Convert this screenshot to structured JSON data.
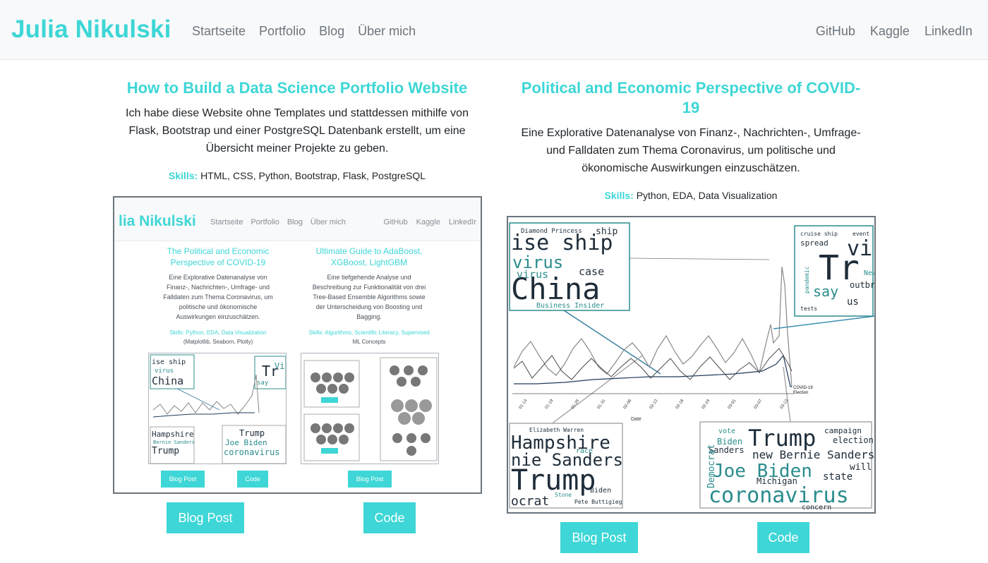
{
  "navbar": {
    "brand": "Julia Nikulski",
    "left_links": [
      "Startseite",
      "Portfolio",
      "Blog",
      "Über mich"
    ],
    "right_links": [
      "GitHub",
      "Kaggle",
      "LinkedIn"
    ]
  },
  "cards": [
    {
      "title": "How to Build a Data Science Portfolio Website",
      "description": "Ich habe diese Website ohne Templates und stattdessen mithilfe von Flask, Bootstrap und einer PostgreSQL Datenbank erstellt, um eine Übersicht meiner Projekte zu geben.",
      "skills_label": "Skills:",
      "skills": "HTML, CSS, Python, Bootstrap, Flask, PostgreSQL",
      "buttons": [
        "Blog Post",
        "Code"
      ]
    },
    {
      "title_line1": "Political and Economic Perspective of COVID-",
      "title_line2": "19",
      "description": "Eine Explorative Datenanalyse von Finanz-, Nachrichten-, Umfrage- und Falldaten zum Thema Coronavirus, um politische und ökonomische Auswirkungen einzuschätzen.",
      "skills_label": "Skills:",
      "skills": "Python, EDA, Data Visualization",
      "buttons": [
        "Blog Post",
        "Code"
      ]
    }
  ],
  "mini_site": {
    "brand": "lia Nikulski",
    "left_links": [
      "Startseite",
      "Portfolio",
      "Blog",
      "Über mich"
    ],
    "right_links": [
      "GitHub",
      "Kaggle",
      "LinkedIr"
    ],
    "cards": [
      {
        "title_line1": "The Political and Economic",
        "title_line2": "Perspective of COVID-19",
        "desc_lines": [
          "Eine Explorative Datenanalyse von",
          "Finanz-, Nachrichten-, Umfrage- und",
          "Falldaten zum Thema Coronavirus, um",
          "politische und ökonomische",
          "Auswirkungen einzuschätzen."
        ],
        "skills_label": "Skills:",
        "skills_line1": "Python, EDA, Data Visualization",
        "skills_line2": "(Matplotlib, Seaborn, Plotly)",
        "buttons": [
          "Blog Post",
          "Code"
        ]
      },
      {
        "title_line1": "Ultimate Guide to AdaBoost,",
        "title_line2": "XGBoost, LightGBM",
        "desc_lines": [
          "Eine tiefgehende Analyse und",
          "Beschreibung zur Funktionalität von drei",
          "Tree-Based Ensemble Algorithms sowie",
          "der Unterscheidung von Boosting und",
          "Bagging."
        ],
        "skills_label": "Skills:",
        "skills_line1": "Algorithms, Scientific Literacy, Supervised",
        "skills_line2": "ML Concepts",
        "buttons": [
          "Blog Post"
        ]
      }
    ]
  },
  "covid_figure": {
    "wordclouds": {
      "top_left": [
        "Diamond Princess",
        "ship",
        "ise ship",
        "virus",
        "case",
        "China",
        "Business Insider",
        "virus"
      ],
      "top_right": [
        "cruise ship",
        "event",
        "spread",
        "Tr",
        "vi",
        "say",
        "outbr",
        "pandemic",
        "us",
        "New",
        "tests"
      ],
      "bottom_left": [
        "Elizabeth Warren",
        "Hampshire",
        "nie Sanders",
        "race",
        "Trump",
        "ocrat",
        "Biden",
        "Pete Buttigieg",
        "Stone"
      ],
      "bottom_right": [
        "vote",
        "Trump",
        "campaign",
        "election",
        "Biden",
        "Sanders",
        "new Bernie Sanders",
        "Joe Biden",
        "will",
        "state",
        "Michigan",
        "coronavirus",
        "concern",
        "Democrat"
      ]
    },
    "x_ticks": [
      "01-13",
      "01-19",
      "01-25",
      "01-31",
      "02-06",
      "02-12",
      "02-18",
      "02-24",
      "03-01",
      "03-07",
      "03-13"
    ],
    "xlabel": "Date",
    "legend": [
      "COVID-19",
      "Election"
    ]
  },
  "mini_figure_words": {
    "covid": [
      "ise ship",
      "virus",
      "China",
      "Tr",
      "Vi",
      "say"
    ],
    "politics": [
      "Hampshire",
      "Bernie Sanders",
      "Trump",
      "Trump",
      "Joe Biden",
      "coronavirus"
    ]
  }
}
